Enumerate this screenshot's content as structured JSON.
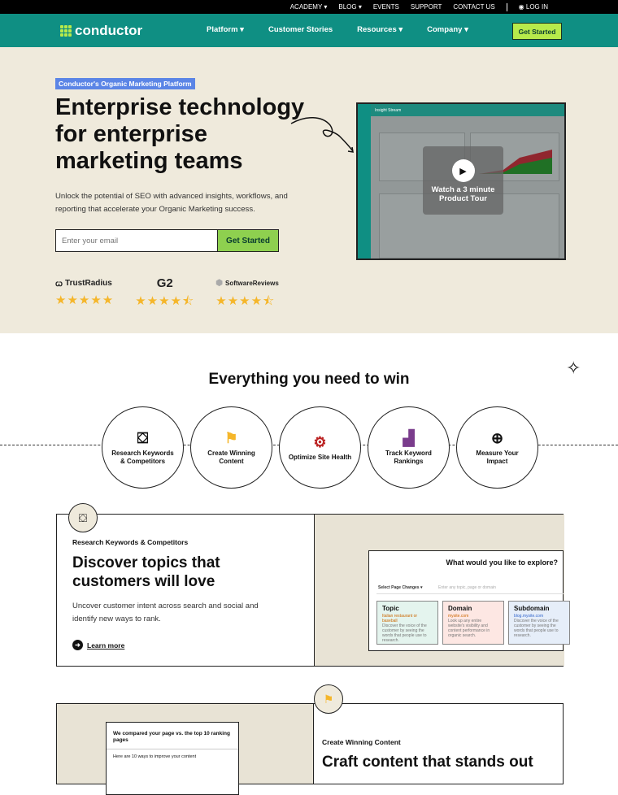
{
  "topbar": {
    "items": [
      "ACADEMY ▾",
      "BLOG ▾",
      "EVENTS",
      "SUPPORT",
      "CONTACT US"
    ],
    "login": "LOG IN"
  },
  "nav": {
    "logo": "conductor",
    "items": [
      "Platform ▾",
      "Customer Stories",
      "Resources ▾",
      "Company ▾"
    ],
    "cta": "Get Started"
  },
  "hero": {
    "tag": "Conductor's Organic Marketing Platform",
    "title": "Enterprise technology for enterprise marketing teams",
    "subtitle": "Unlock the potential of SEO with advanced insights, workflows, and reporting that accelerate your Organic Marketing success.",
    "email_placeholder": "Enter your email",
    "cta": "Get Started",
    "ratings": [
      {
        "brand": "TrustRadius",
        "stars": "★★★★★"
      },
      {
        "brand": "G2",
        "stars": "★★★★⯪"
      },
      {
        "brand": "SoftwareReviews",
        "stars": "★★★★⯪"
      }
    ],
    "video": {
      "app_title": "Insight Stream",
      "cta": "Watch a 3 minute Product Tour"
    }
  },
  "win": {
    "title": "Everything you need to win",
    "steps": [
      {
        "label": "Research Keywords & Competitors",
        "icon": "presentation-icon"
      },
      {
        "label": "Create Winning Content",
        "icon": "flag-icon"
      },
      {
        "label": "Optimize Site Health",
        "icon": "monitor-gear-icon"
      },
      {
        "label": "Track Keyword Rankings",
        "icon": "chart-icon"
      },
      {
        "label": "Measure Your Impact",
        "icon": "magnifier-icon"
      }
    ]
  },
  "card1": {
    "tag": "Research Keywords & Competitors",
    "title": "Discover topics that customers will love",
    "body": "Uncover customer intent across search and social and identify new ways to rank.",
    "link": "Learn more",
    "explore": {
      "title": "What would you like to explore?",
      "select": "Select Page Changes",
      "placeholder": "Enter any topic, page or domain",
      "tiles": [
        {
          "name": "Topic",
          "example": "Italian restaurant or baseball",
          "desc": "Discover the voice of the customer by seeing the words that people use to research."
        },
        {
          "name": "Domain",
          "example": "mysite.com",
          "desc": "Look up any entire website's visibility and content performance in organic search."
        },
        {
          "name": "Subdomain",
          "example": "blog.mysite.com",
          "desc": "Discover the voice of the customer by seeing the words that people use to research."
        }
      ]
    }
  },
  "card2": {
    "tag": "Create Winning Content",
    "title": "Craft content that stands out",
    "compare_title": "We compared your page vs. the top 10 ranking pages",
    "compare_sub": "Here are 10 ways to improve your content"
  },
  "colors": {
    "teal": "#0f8f83",
    "lime": "#b7ea4b",
    "cream": "#efeadc",
    "blue_tag": "#5b85e6",
    "star": "#f5b62a"
  }
}
